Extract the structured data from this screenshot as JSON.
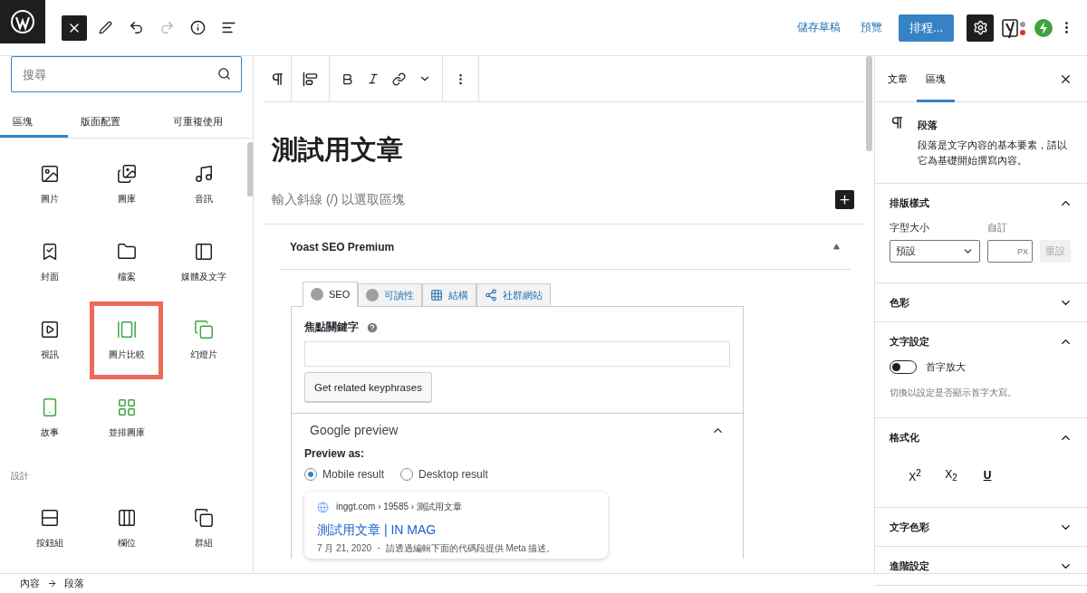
{
  "topbar": {
    "left_tools": [
      {
        "kind": "close",
        "selected": true,
        "disabled": false
      },
      {
        "kind": "pen",
        "selected": false,
        "disabled": false
      },
      {
        "kind": "undo",
        "selected": false,
        "disabled": false
      },
      {
        "kind": "redo",
        "selected": false,
        "disabled": true
      },
      {
        "kind": "info",
        "selected": false,
        "disabled": false
      },
      {
        "kind": "list",
        "selected": false,
        "disabled": false
      }
    ],
    "save_draft": "儲存草稿",
    "preview": "預覽",
    "publish": "排程...",
    "settings_selected": true
  },
  "inserter": {
    "search": {
      "placeholder": "搜尋"
    },
    "tabs": [
      {
        "label": "區塊",
        "selected": true
      },
      {
        "label": "版面配置",
        "selected": false
      },
      {
        "label": "可重複使用",
        "selected": false
      }
    ],
    "sections": [
      {
        "blocks": [
          {
            "label": "圖片",
            "kind": "image",
            "color": "#1e1e1e",
            "highlighted": false
          },
          {
            "label": "圖庫",
            "kind": "gallery",
            "color": "#1e1e1e",
            "highlighted": false
          },
          {
            "label": "音訊",
            "kind": "audio",
            "color": "#1e1e1e",
            "highlighted": false
          },
          {
            "label": "封面",
            "kind": "cover",
            "color": "#1e1e1e",
            "highlighted": false
          },
          {
            "label": "檔案",
            "kind": "file",
            "color": "#1e1e1e",
            "highlighted": false
          },
          {
            "label": "媒體及文字",
            "kind": "media-text",
            "color": "#1e1e1e",
            "highlighted": false
          },
          {
            "label": "視訊",
            "kind": "video",
            "color": "#1e1e1e",
            "highlighted": false
          },
          {
            "label": "圖片比較",
            "kind": "compare",
            "color": "#3ea33e",
            "highlighted": true
          },
          {
            "label": "幻燈片",
            "kind": "slideshow",
            "color": "#3ea33e",
            "highlighted": false
          },
          {
            "label": "故事",
            "kind": "story",
            "color": "#3ea33e",
            "highlighted": false
          },
          {
            "label": "並排圖庫",
            "kind": "tiled",
            "color": "#3ea33e",
            "highlighted": false
          }
        ]
      },
      {
        "heading": "設計",
        "blocks": [
          {
            "label": "按鈕組",
            "kind": "buttons",
            "color": "#1e1e1e",
            "highlighted": false
          },
          {
            "label": "欄位",
            "kind": "columns",
            "color": "#1e1e1e",
            "highlighted": false
          },
          {
            "label": "群組",
            "kind": "group",
            "color": "#1e1e1e",
            "highlighted": false
          }
        ]
      }
    ]
  },
  "editor": {
    "title": "測試用文章",
    "block_placeholder": "輸入斜線 (/) 以選取區塊",
    "yoast": {
      "title": "Yoast SEO Premium",
      "expanded": true,
      "tabs": [
        {
          "label": "SEO",
          "kind": "dot",
          "selected": true
        },
        {
          "label": "可讀性",
          "kind": "dot",
          "selected": false
        },
        {
          "label": "結構",
          "kind": "grid",
          "selected": false
        },
        {
          "label": "社群網站",
          "kind": "share",
          "selected": false
        }
      ],
      "focus_keyphrase_label": "焦點關鍵字",
      "related_button": "Get related keyphrases",
      "google_preview": {
        "title": "Google preview",
        "expanded": true,
        "preview_as": "Preview as:",
        "options": [
          {
            "label": "Mobile result",
            "selected": true
          },
          {
            "label": "Desktop result",
            "selected": false
          }
        ],
        "breadcrumb": "inggt.com › 19585 › 測試用文章",
        "result_title": "測試用文章 | IN MAG",
        "snippet": "7 月 21, 2020 ・ 請透過編輯下面的代碼段提供 Meta 描述。"
      }
    }
  },
  "sidebar": {
    "tabs": [
      {
        "label": "文章",
        "selected": false
      },
      {
        "label": "區塊",
        "selected": true
      }
    ],
    "block": {
      "name": "段落",
      "description": "段落是文字內容的基本要素，請以它為基礎開始撰寫內容。"
    },
    "typography": {
      "title": "排版樣式",
      "expanded": true,
      "size_label": "字型大小",
      "custom_label": "自訂",
      "size_value": "預設",
      "unit": "PX",
      "reset": "重設"
    },
    "color": {
      "title": "色彩",
      "expanded": false
    },
    "text_settings": {
      "title": "文字設定",
      "expanded": true,
      "toggle_label": "首字放大",
      "toggle_on": false,
      "help": "切換以設定是否顯示首字大寫。"
    },
    "formatting": {
      "title": "格式化",
      "expanded": true,
      "buttons": [
        {
          "label": "X$^{2}$"
        },
        {
          "label": "X$_{2}$"
        },
        {
          "label": "U",
          "kind": "underline"
        }
      ]
    },
    "text_color": {
      "title": "文字色彩",
      "expanded": false
    },
    "advanced": {
      "title": "進階設定",
      "expanded": false
    }
  },
  "breadcrumbs": [
    {
      "label": "內容"
    },
    {
      "label": "段落"
    }
  ]
}
